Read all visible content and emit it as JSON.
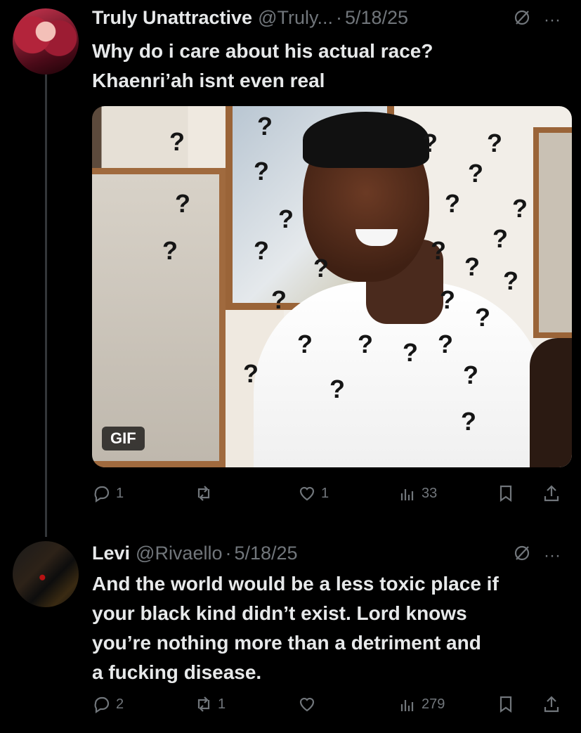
{
  "posts": [
    {
      "author_name": "Truly Unattractive",
      "handle": "@Truly...",
      "separator": "·",
      "date": "5/18/25",
      "text": "Why do i care about his actual race?\nKhaenri’ah isnt even real",
      "media": {
        "badge": "GIF",
        "overlay_glyph": "?"
      },
      "actions": {
        "reply_count": "1",
        "repost_count": "",
        "like_count": "1",
        "views_count": "33"
      },
      "icons": [
        "grok-icon",
        "more-icon",
        "reply-icon",
        "repost-icon",
        "like-icon",
        "views-icon",
        "bookmark-icon",
        "share-icon"
      ]
    },
    {
      "author_name": "Levi",
      "handle": "@Rivaello",
      "separator": "·",
      "date": "5/18/25",
      "text": "And the world would be a less toxic place if\nyour black kind didn’t exist. Lord knows\nyou’re nothing more than a detriment and\na fucking disease.",
      "actions": {
        "reply_count": "2",
        "repost_count": "1",
        "like_count": "",
        "views_count": "279"
      }
    }
  ],
  "more_glyph": "···",
  "colors": {
    "background": "#000000",
    "text": "#e7e9ea",
    "muted": "#71767b",
    "thread_line": "#333639"
  }
}
